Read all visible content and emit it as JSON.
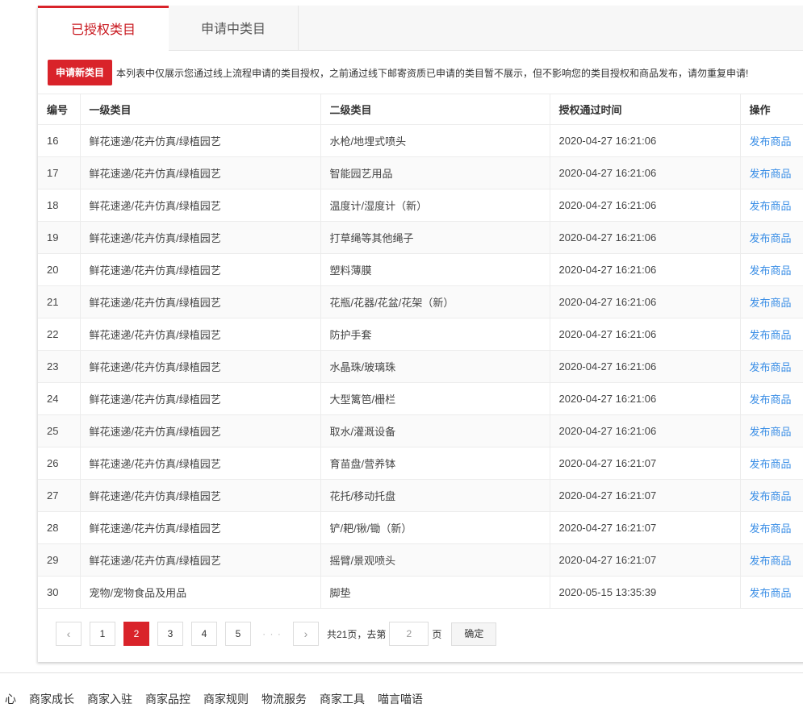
{
  "tabs": {
    "authorized": "已授权类目",
    "applying": "申请中类目"
  },
  "notice": {
    "apply_button": "申请新类目",
    "text": "本列表中仅展示您通过线上流程申请的类目授权，之前通过线下邮寄资质已申请的类目暂不展示，但不影响您的类目授权和商品发布，请勿重复申请!"
  },
  "table": {
    "headers": [
      "编号",
      "一级类目",
      "二级类目",
      "授权通过时间",
      "操作"
    ],
    "action_label": "发布商品",
    "rows": [
      {
        "id": "16",
        "level1": "鲜花速递/花卉仿真/绿植园艺",
        "level2": "水枪/地埋式喷头",
        "time": "2020-04-27 16:21:06"
      },
      {
        "id": "17",
        "level1": "鲜花速递/花卉仿真/绿植园艺",
        "level2": "智能园艺用品",
        "time": "2020-04-27 16:21:06"
      },
      {
        "id": "18",
        "level1": "鲜花速递/花卉仿真/绿植园艺",
        "level2": "温度计/湿度计（新）",
        "time": "2020-04-27 16:21:06"
      },
      {
        "id": "19",
        "level1": "鲜花速递/花卉仿真/绿植园艺",
        "level2": "打草绳等其他绳子",
        "time": "2020-04-27 16:21:06"
      },
      {
        "id": "20",
        "level1": "鲜花速递/花卉仿真/绿植园艺",
        "level2": "塑料薄膜",
        "time": "2020-04-27 16:21:06"
      },
      {
        "id": "21",
        "level1": "鲜花速递/花卉仿真/绿植园艺",
        "level2": "花瓶/花器/花盆/花架（新）",
        "time": "2020-04-27 16:21:06"
      },
      {
        "id": "22",
        "level1": "鲜花速递/花卉仿真/绿植园艺",
        "level2": "防护手套",
        "time": "2020-04-27 16:21:06"
      },
      {
        "id": "23",
        "level1": "鲜花速递/花卉仿真/绿植园艺",
        "level2": "水晶珠/玻璃珠",
        "time": "2020-04-27 16:21:06"
      },
      {
        "id": "24",
        "level1": "鲜花速递/花卉仿真/绿植园艺",
        "level2": "大型篱笆/栅栏",
        "time": "2020-04-27 16:21:06"
      },
      {
        "id": "25",
        "level1": "鲜花速递/花卉仿真/绿植园艺",
        "level2": "取水/灌溉设备",
        "time": "2020-04-27 16:21:06"
      },
      {
        "id": "26",
        "level1": "鲜花速递/花卉仿真/绿植园艺",
        "level2": "育苗盘/营养钵",
        "time": "2020-04-27 16:21:07"
      },
      {
        "id": "27",
        "level1": "鲜花速递/花卉仿真/绿植园艺",
        "level2": "花托/移动托盘",
        "time": "2020-04-27 16:21:07"
      },
      {
        "id": "28",
        "level1": "鲜花速递/花卉仿真/绿植园艺",
        "level2": "铲/耙/锹/锄（新）",
        "time": "2020-04-27 16:21:07"
      },
      {
        "id": "29",
        "level1": "鲜花速递/花卉仿真/绿植园艺",
        "level2": "摇臂/景观喷头",
        "time": "2020-04-27 16:21:07"
      },
      {
        "id": "30",
        "level1": "宠物/宠物食品及用品",
        "level2": "脚垫",
        "time": "2020-05-15 13:35:39"
      }
    ]
  },
  "pager": {
    "prev": "‹",
    "next": "›",
    "pages": [
      "1",
      "2",
      "3",
      "4",
      "5"
    ],
    "current": "2",
    "dots": "· · ·",
    "total_text": "共21页，去第",
    "goto_value": "2",
    "page_suffix": "页",
    "confirm": "确定"
  },
  "footer": {
    "links": [
      "心",
      "商家成长",
      "商家入驻",
      "商家品控",
      "商家规则",
      "物流服务",
      "商家工具",
      "喵言喵语"
    ]
  },
  "colors": {
    "accent": "#d9232a",
    "link": "#3a8ee6"
  }
}
